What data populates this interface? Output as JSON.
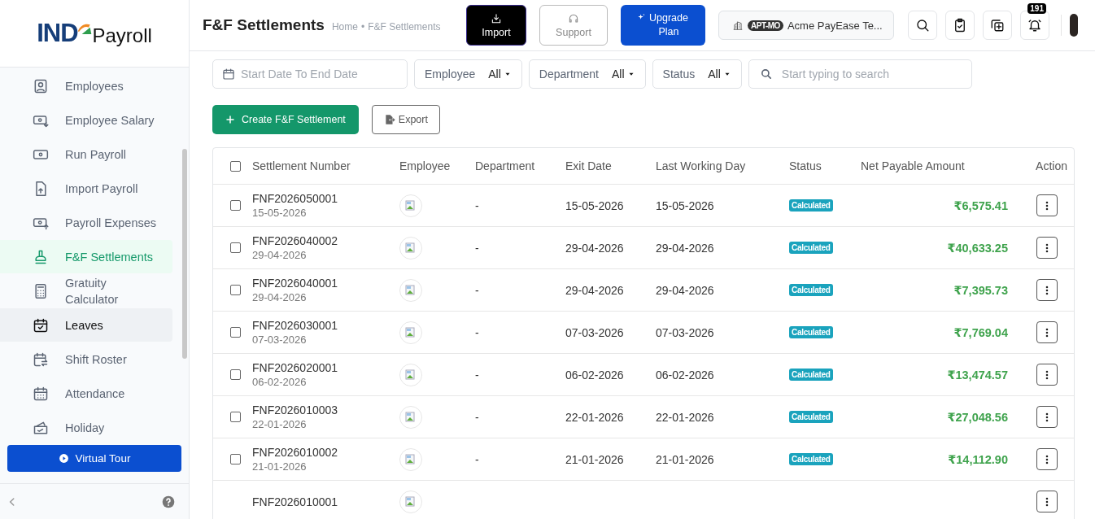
{
  "brand": {
    "mark": "IND",
    "name": "Payroll"
  },
  "sidebar": {
    "items": [
      {
        "label": "Employees",
        "selected": false,
        "hovered": false
      },
      {
        "label": "Employee Salary",
        "selected": false,
        "hovered": false
      },
      {
        "label": "Run Payroll",
        "selected": false,
        "hovered": false
      },
      {
        "label": "Import Payroll",
        "selected": false,
        "hovered": false
      },
      {
        "label": "Payroll Expenses",
        "selected": false,
        "hovered": false
      },
      {
        "label": "F&F Settlements",
        "selected": true,
        "hovered": false
      },
      {
        "label": "Gratuity Calculator",
        "selected": false,
        "hovered": false
      },
      {
        "label": "Leaves",
        "selected": false,
        "hovered": true
      },
      {
        "label": "Shift Roster",
        "selected": false,
        "hovered": false
      },
      {
        "label": "Attendance",
        "selected": false,
        "hovered": false
      },
      {
        "label": "Holiday",
        "selected": false,
        "hovered": false
      }
    ],
    "tour_button": "Virtual Tour"
  },
  "header": {
    "title": "F&F Settlements",
    "breadcrumb": [
      "Home",
      "F&F Settlements"
    ],
    "breadcrumb_separator": "•",
    "buttons": [
      {
        "label": "Import",
        "kind": "dark"
      },
      {
        "label": "Support",
        "kind": "outline"
      },
      {
        "label": "Upgrade Plan",
        "kind": "primary"
      }
    ],
    "company": {
      "code": "APT-MO",
      "name": "Acme PayEase Te..."
    },
    "notification_count": "191"
  },
  "filters": {
    "date_placeholder": "Start Date To End Date",
    "dropdowns": [
      {
        "label": "Employee",
        "value": "All"
      },
      {
        "label": "Department",
        "value": "All"
      },
      {
        "label": "Status",
        "value": "All"
      }
    ],
    "search_placeholder": "Start typing to search"
  },
  "actions": {
    "create": "Create F&F Settlement",
    "export": "Export"
  },
  "table": {
    "select_all_checked": false,
    "columns": [
      "Settlement Number",
      "Employee",
      "Department",
      "Exit Date",
      "Last Working Day",
      "Status",
      "Net Payable Amount",
      "Action"
    ],
    "rows": [
      {
        "number": "FNF2026050001",
        "date": "15-05-2026",
        "department": "-",
        "exit_date": "15-05-2026",
        "last_day": "15-05-2026",
        "status": "Calculated",
        "amount": "₹6,575.41",
        "checked": false
      },
      {
        "number": "FNF2026040002",
        "date": "29-04-2026",
        "department": "-",
        "exit_date": "29-04-2026",
        "last_day": "29-04-2026",
        "status": "Calculated",
        "amount": "₹40,633.25",
        "checked": false
      },
      {
        "number": "FNF2026040001",
        "date": "29-04-2026",
        "department": "-",
        "exit_date": "29-04-2026",
        "last_day": "29-04-2026",
        "status": "Calculated",
        "amount": "₹7,395.73",
        "checked": false
      },
      {
        "number": "FNF2026030001",
        "date": "07-03-2026",
        "department": "-",
        "exit_date": "07-03-2026",
        "last_day": "07-03-2026",
        "status": "Calculated",
        "amount": "₹7,769.04",
        "checked": false
      },
      {
        "number": "FNF2026020001",
        "date": "06-02-2026",
        "department": "-",
        "exit_date": "06-02-2026",
        "last_day": "06-02-2026",
        "status": "Calculated",
        "amount": "₹13,474.57",
        "checked": false
      },
      {
        "number": "FNF2026010003",
        "date": "22-01-2026",
        "department": "-",
        "exit_date": "22-01-2026",
        "last_day": "22-01-2026",
        "status": "Calculated",
        "amount": "₹27,048.56",
        "checked": false
      },
      {
        "number": "FNF2026010002",
        "date": "21-01-2026",
        "department": "-",
        "exit_date": "21-01-2026",
        "last_day": "21-01-2026",
        "status": "Calculated",
        "amount": "₹14,112.90",
        "checked": false
      },
      {
        "number": "FNF2026010001"
      }
    ]
  }
}
